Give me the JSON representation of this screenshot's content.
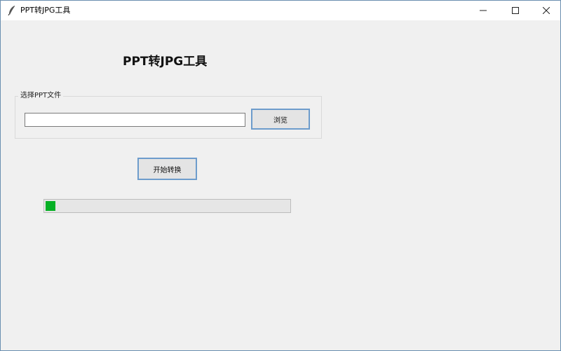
{
  "window": {
    "title": "PPT转JPG工具",
    "app_icon": "feather-icon",
    "controls": {
      "minimize": "minimize-icon",
      "maximize": "maximize-icon",
      "close": "close-icon"
    }
  },
  "main": {
    "heading": "PPT转JPG工具",
    "file_group": {
      "legend": "选择PPT文件",
      "path_value": "",
      "browse_label": "浏览"
    },
    "start_label": "开始转换",
    "progress": {
      "value": 0.04,
      "color": "#06b025"
    }
  }
}
